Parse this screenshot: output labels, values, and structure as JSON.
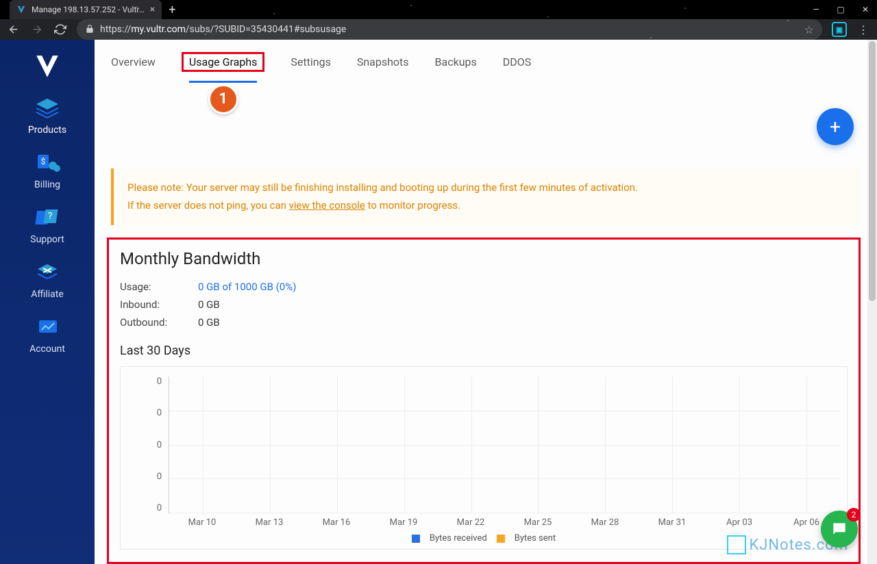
{
  "browser": {
    "tab_title": "Manage 198.13.57.252 - Vultr…",
    "url_prefix": "https://",
    "url_host": "my.vultr.com",
    "url_path": "/subs/?SUBID=35430441#subsusage"
  },
  "sidebar": {
    "items": [
      {
        "label": "Products"
      },
      {
        "label": "Billing"
      },
      {
        "label": "Support"
      },
      {
        "label": "Affiliate"
      },
      {
        "label": "Account"
      }
    ]
  },
  "tabs": {
    "items": [
      {
        "label": "Overview",
        "active": false
      },
      {
        "label": "Usage Graphs",
        "active": true
      },
      {
        "label": "Settings",
        "active": false
      },
      {
        "label": "Snapshots",
        "active": false
      },
      {
        "label": "Backups",
        "active": false
      },
      {
        "label": "DDOS",
        "active": false
      }
    ],
    "highlight_badge": "1"
  },
  "notice": {
    "line1_pre": "Please note: Your server may still be finishing installing and booting up during the first few minutes of activation.",
    "line2_pre": "If the server does not ping, you can ",
    "link": "view the console",
    "line2_post": " to monitor progress."
  },
  "bandwidth": {
    "title": "Monthly Bandwidth",
    "usage_label": "Usage:",
    "usage_value": "0 GB of 1000 GB (0%)",
    "inbound_label": "Inbound:",
    "inbound_value": "0 GB",
    "outbound_label": "Outbound:",
    "outbound_value": "0 GB",
    "last30_title": "Last 30 Days"
  },
  "chart_data": {
    "type": "bar",
    "categories": [
      "Mar 10",
      "Mar 13",
      "Mar 16",
      "Mar 19",
      "Mar 22",
      "Mar 25",
      "Mar 28",
      "Mar 31",
      "Apr 03",
      "Apr 06"
    ],
    "series": [
      {
        "name": "Bytes received",
        "values": [
          0,
          0,
          0,
          0,
          0,
          0,
          0,
          0,
          0,
          0
        ],
        "color": "#2a6fe0"
      },
      {
        "name": "Bytes sent",
        "values": [
          0,
          0,
          0,
          0,
          0,
          0,
          0,
          0,
          0,
          0
        ],
        "color": "#f5a623"
      }
    ],
    "ylabel": "",
    "xlabel": "",
    "y_ticks": [
      0,
      0,
      0,
      0,
      0
    ],
    "ylim": [
      0,
      0
    ],
    "title": ""
  },
  "chat": {
    "badge": "2"
  },
  "watermark": "KJNotes.com"
}
